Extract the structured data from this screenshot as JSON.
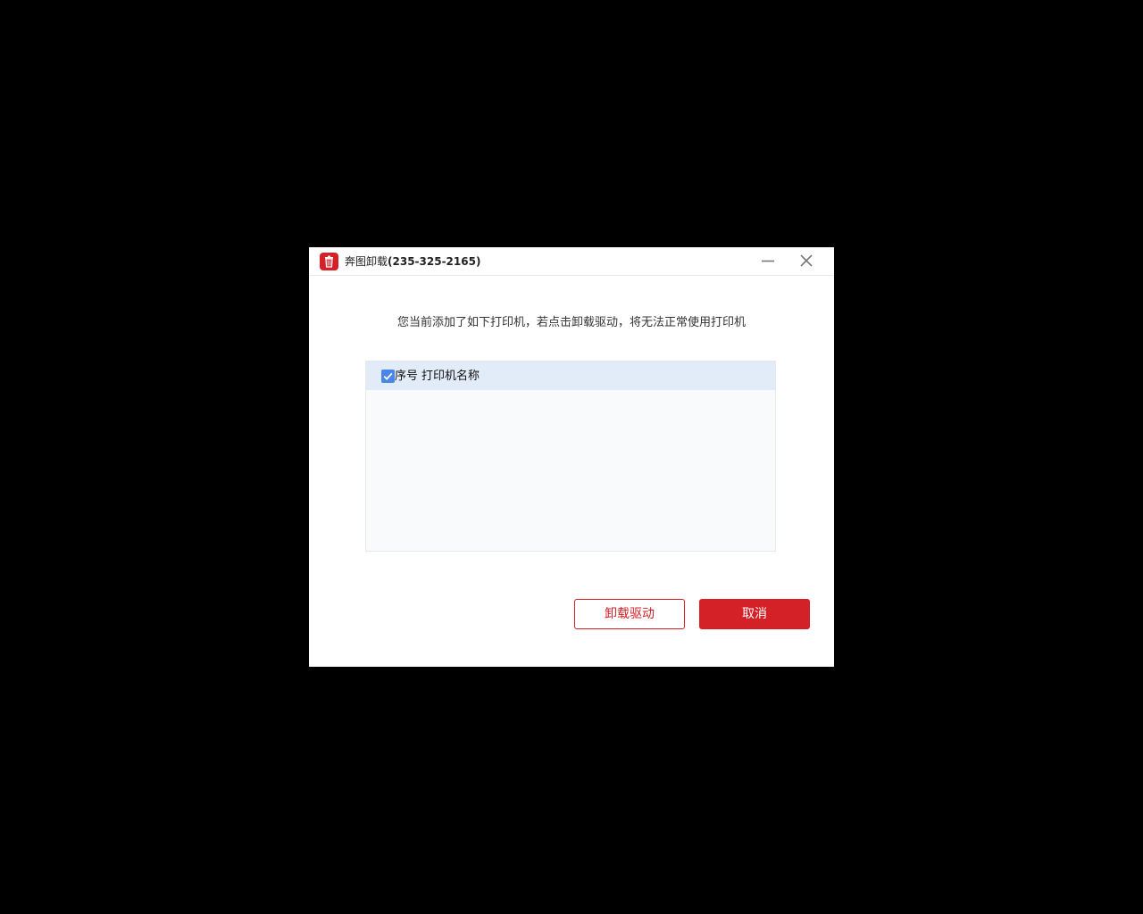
{
  "window": {
    "title_prefix": "奔图卸载",
    "title_id": "(235-325-2165)",
    "app_icon": "trash-icon",
    "minimize_icon": "minimize-icon",
    "close_icon": "close-icon"
  },
  "message": "您当前添加了如下打印机，若点击卸载驱动，将无法正常使用打印机",
  "printer_list": {
    "select_all_checked": true,
    "columns": [
      "序号",
      "打印机名称"
    ],
    "rows": []
  },
  "buttons": {
    "uninstall_label": "卸载驱动",
    "cancel_label": "取消"
  },
  "colors": {
    "brand_red": "#d42027",
    "checkbox_blue": "#4a86e8",
    "header_bg": "#e2ebf8"
  }
}
